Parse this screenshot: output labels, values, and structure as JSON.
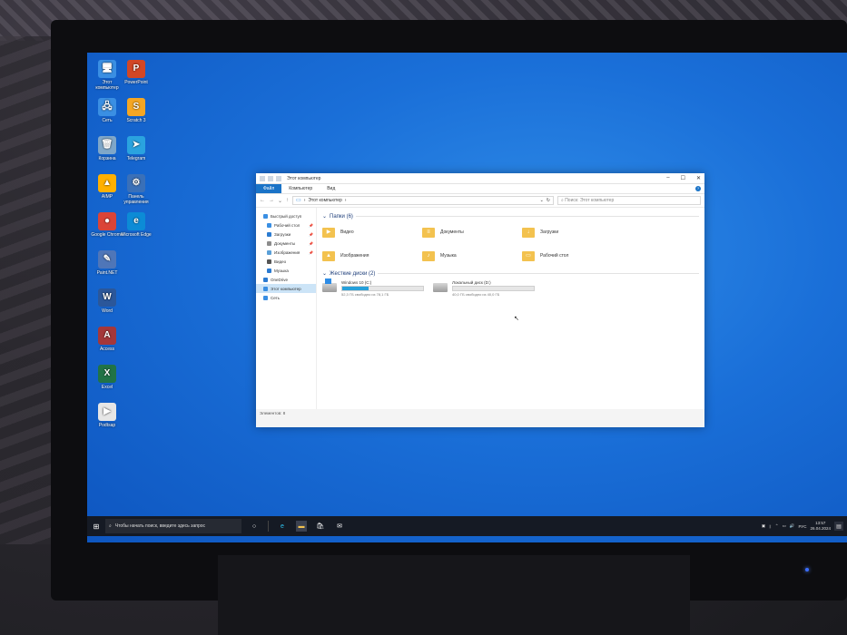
{
  "desktop": {
    "icons": [
      {
        "label": "Этот компьютер",
        "glyph": "🖥",
        "color": "#3a8fe3"
      },
      {
        "label": "PowerPoint",
        "glyph": "P",
        "color": "#d24726"
      },
      {
        "label": "Сеть",
        "glyph": "🖧",
        "color": "#3a8fe3"
      },
      {
        "label": "Scratch 3",
        "glyph": "S",
        "color": "#f5a623"
      },
      {
        "label": "Корзина",
        "glyph": "🗑",
        "color": "#7fa7c9"
      },
      {
        "label": "Telegram",
        "glyph": "➤",
        "color": "#2aa3df"
      },
      {
        "label": "AIMP",
        "glyph": "▲",
        "color": "#ffb000"
      },
      {
        "label": "Панель управления",
        "glyph": "⚙",
        "color": "#3a70b8"
      },
      {
        "label": "Google Chrome",
        "glyph": "●",
        "color": "#db4437"
      },
      {
        "label": "Microsoft Edge",
        "glyph": "e",
        "color": "#0c8bd6"
      },
      {
        "label": "Paint.NET",
        "glyph": "✎",
        "color": "#4f76b8"
      },
      {
        "label": "Word",
        "glyph": "W",
        "color": "#2b579a"
      },
      {
        "label": "Access",
        "glyph": "A",
        "color": "#a4373a"
      },
      {
        "label": "Excel",
        "glyph": "X",
        "color": "#217346"
      },
      {
        "label": "Podtsap",
        "glyph": "▶",
        "color": "#e6e6e6"
      }
    ]
  },
  "explorer": {
    "title": "Этот компьютер",
    "ribbon_tabs": [
      "Файл",
      "Компьютер",
      "Вид"
    ],
    "address": "Этот компьютер",
    "search_placeholder": "Поиск: Этот компьютер",
    "nav_items": [
      {
        "label": "Быстрый доступ",
        "color": "#3a8fe3",
        "pin": false,
        "sub": false
      },
      {
        "label": "Рабочий стол",
        "color": "#3a8fe3",
        "pin": true,
        "sub": true
      },
      {
        "label": "Загрузки",
        "color": "#2b7bd1",
        "pin": true,
        "sub": true
      },
      {
        "label": "Документы",
        "color": "#8c8c8c",
        "pin": true,
        "sub": true
      },
      {
        "label": "Изображения",
        "color": "#5aa0d8",
        "pin": true,
        "sub": true
      },
      {
        "label": "Видео",
        "color": "#555",
        "pin": false,
        "sub": true
      },
      {
        "label": "Музыка",
        "color": "#2b7bd1",
        "pin": false,
        "sub": true
      },
      {
        "label": "OneDrive",
        "color": "#2b7bd1",
        "pin": false,
        "sub": false
      },
      {
        "label": "Этот компьютер",
        "color": "#3a8fe3",
        "pin": false,
        "sub": false,
        "selected": true
      },
      {
        "label": "Сеть",
        "color": "#3a8fe3",
        "pin": false,
        "sub": false
      }
    ],
    "folders_section": "Папки (6)",
    "folders": [
      {
        "label": "Видео",
        "mark": "▶"
      },
      {
        "label": "Документы",
        "mark": "≡"
      },
      {
        "label": "Загрузки",
        "mark": "↓"
      },
      {
        "label": "Изображения",
        "mark": "▲"
      },
      {
        "label": "Музыка",
        "mark": "♪"
      },
      {
        "label": "Рабочий стол",
        "mark": "▭"
      }
    ],
    "drives_section": "Жесткие диски (2)",
    "drives": [
      {
        "label": "Windows 10 (C:)",
        "free": "52,3 ГБ свободно из 78,1 ГБ",
        "used_fraction": 0.33,
        "system": true
      },
      {
        "label": "Локальный диск (D:)",
        "free": "40,0 ГБ свободно из 40,0 ГБ",
        "used_fraction": 0.0,
        "system": false
      }
    ],
    "status": "Элементов: 8"
  },
  "taskbar": {
    "search_placeholder": "Чтобы начать поиск, введите здесь запрос",
    "lang": "РУС",
    "time": "13:57",
    "date": "26.04.2024"
  }
}
